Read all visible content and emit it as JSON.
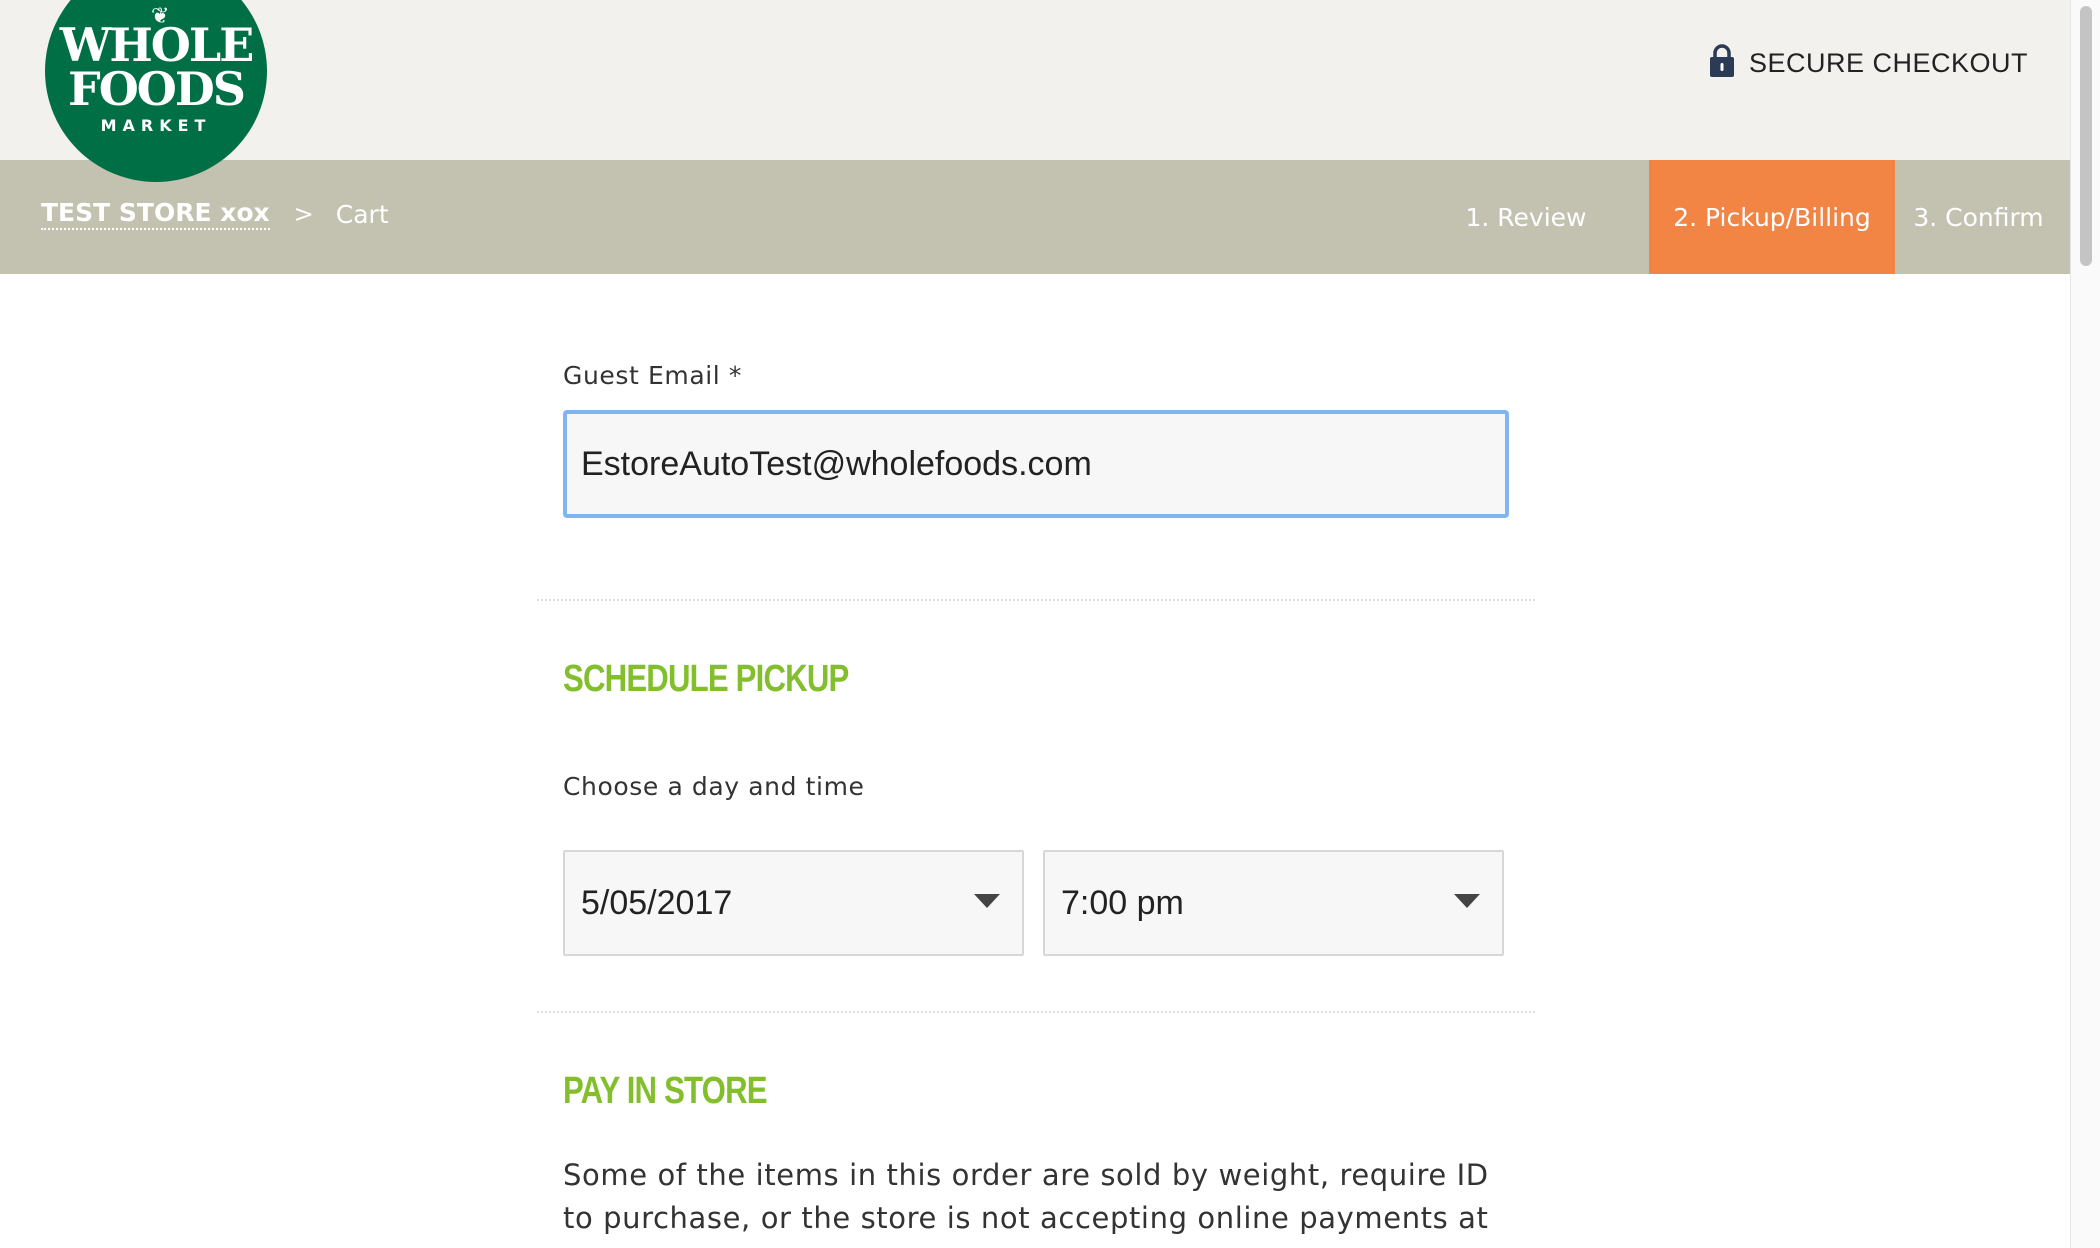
{
  "header": {
    "logo": {
      "line1": "WHOLE",
      "line2": "FOODS",
      "line3": "MARKET"
    },
    "secure_label": "SECURE CHECKOUT",
    "secure_icon": "lock-icon"
  },
  "breadcrumb": {
    "store": "TEST STORE xox",
    "separator": ">",
    "current": "Cart"
  },
  "steps": [
    {
      "label": "1. Review",
      "active": false
    },
    {
      "label": "2. Pickup/Billing",
      "active": true
    },
    {
      "label": "3. Confirm",
      "active": false
    }
  ],
  "form": {
    "email": {
      "label": "Guest Email *",
      "value": "EstoreAutoTest@wholefoods.com"
    },
    "schedule": {
      "title": "SCHEDULE PICKUP",
      "prompt": "Choose a day and time",
      "date_value": "5/05/2017",
      "time_value": "7:00 pm"
    },
    "pay": {
      "title": "PAY IN STORE",
      "text": "Some of the items in this order are sold by weight, require ID to purchase, or the store is not accepting online payments at this"
    }
  },
  "colors": {
    "brand_green": "#006f46",
    "active_step": "#f28444",
    "nav_bar": "#c3c2b1",
    "section_title": "#83bf2c",
    "focus_ring": "#7fb5f3"
  }
}
